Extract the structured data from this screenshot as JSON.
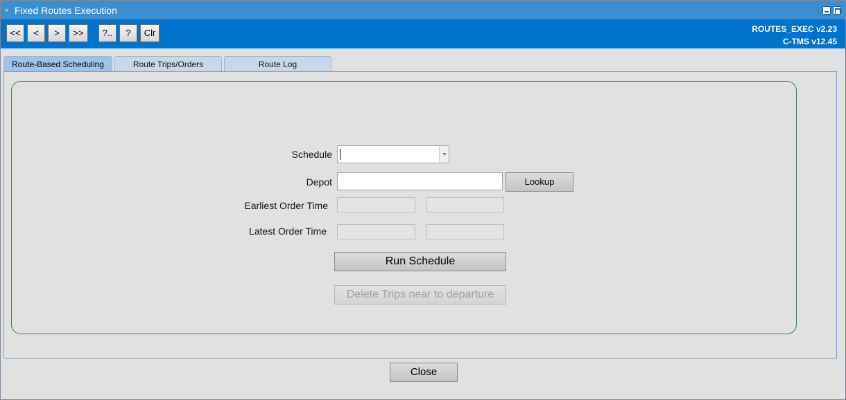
{
  "window": {
    "title": "Fixed Routes Execution",
    "app_icon": "«",
    "version_line1": "ROUTES_EXEC v2.23",
    "version_line2": "C-TMS v12.45"
  },
  "toolbar": {
    "first": "<<",
    "prev": "<",
    "next": ">",
    "last": ">>",
    "query": "?..",
    "help": "?",
    "clear": "Clr"
  },
  "tabs": [
    {
      "label": "Route-Based Scheduling",
      "active": true
    },
    {
      "label": "Route Trips/Orders",
      "active": false
    },
    {
      "label": "Route Log",
      "active": false
    }
  ],
  "form": {
    "schedule_label": "Schedule",
    "schedule_value": "",
    "depot_label": "Depot",
    "depot_value": "",
    "lookup_label": "Lookup",
    "earliest_label": "Earliest Order Time",
    "earliest_date": "",
    "earliest_time": "",
    "latest_label": "Latest Order Time",
    "latest_date": "",
    "latest_time": "",
    "run_label": "Run Schedule",
    "delete_label": "Delete Trips near to departure"
  },
  "footer": {
    "close_label": "Close"
  },
  "colors": {
    "titlebar": "#3a8fd0",
    "toolbar": "#0073cc",
    "active_tab": "#9ec3e6",
    "inactive_tab": "#c9d8e8"
  }
}
